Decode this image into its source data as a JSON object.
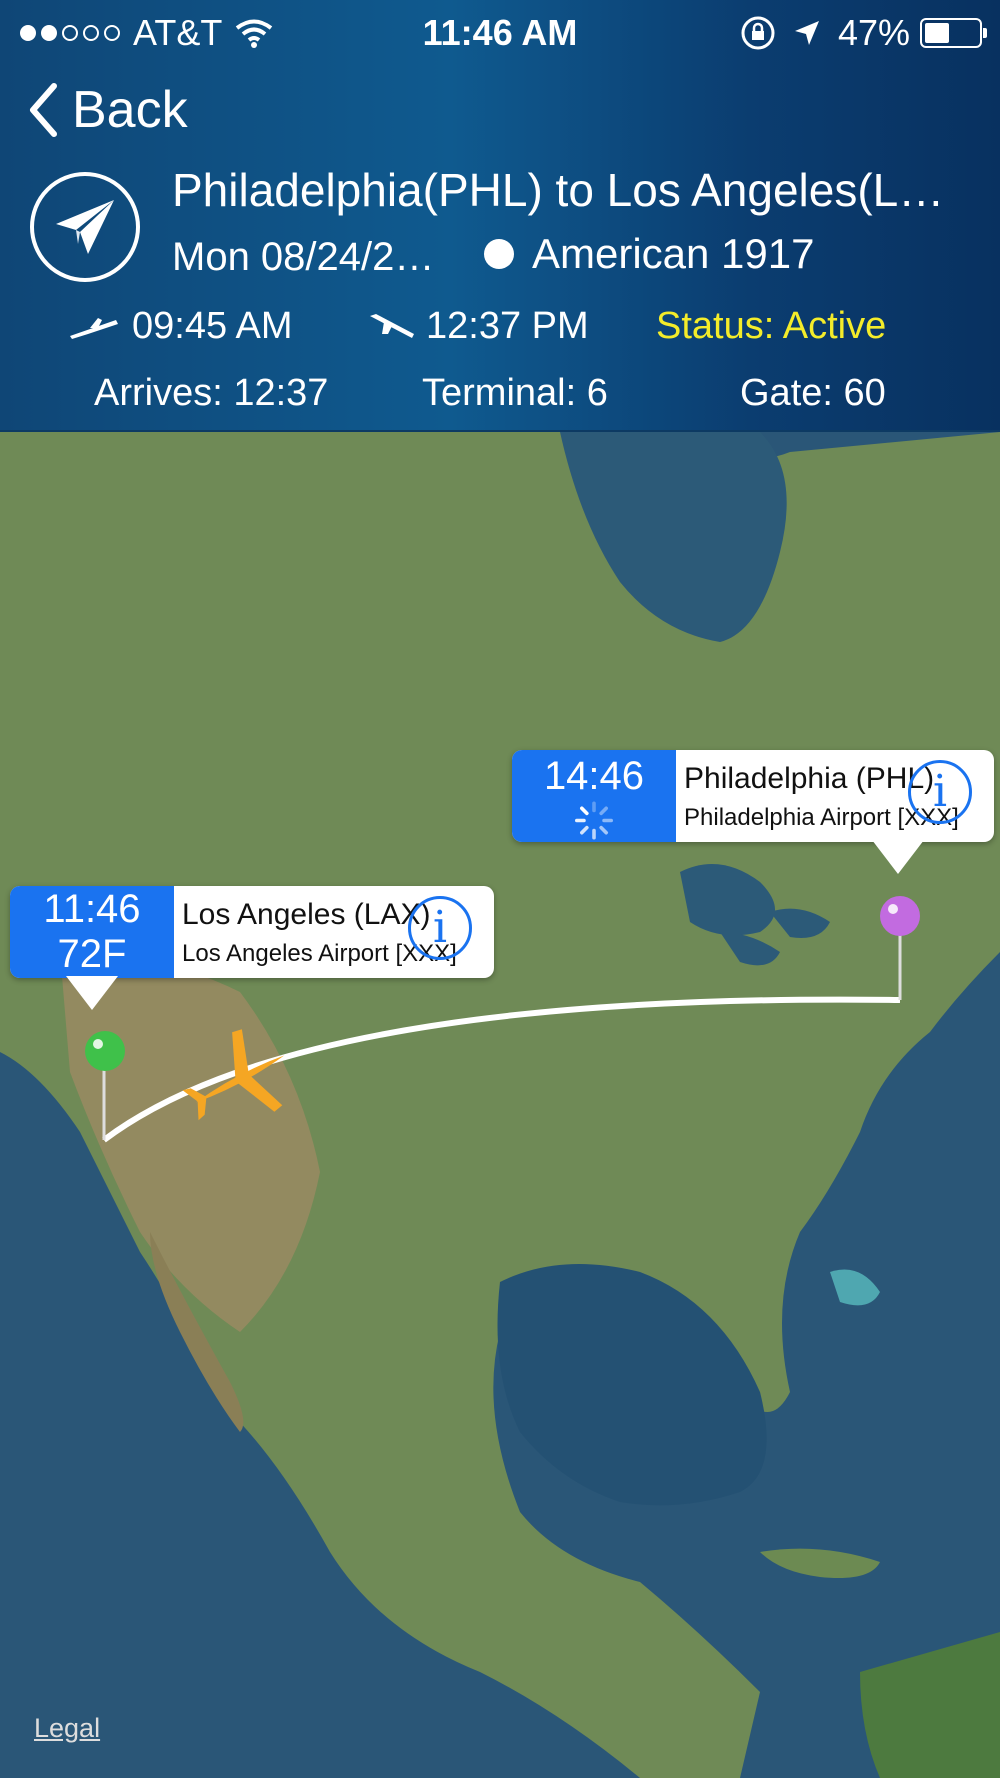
{
  "status_bar": {
    "carrier": "AT&T",
    "signal_full": 2,
    "signal_total": 5,
    "time": "11:46 AM",
    "battery": "47%",
    "battery_level": 0.47
  },
  "nav": {
    "back_label": "Back"
  },
  "flight": {
    "route": "Philadelphia(PHL) to Los Angeles(L…",
    "date": "Mon 08/24/2…",
    "airline": "American 1917",
    "departure_time": "09:45 AM",
    "arrival_time": "12:37 PM",
    "status": "Status: Active",
    "arrives": "Arrives: 12:37",
    "terminal": "Terminal: 6",
    "gate": "Gate: 60"
  },
  "map": {
    "origin": {
      "time": "14:46",
      "name": "Philadelphia (PHL)",
      "airport": "Philadelphia Airport [XXX]",
      "pin_color": "#c26be0"
    },
    "destination": {
      "time": "11:46",
      "temp": "72F",
      "name": "Los Angeles (LAX)",
      "airport": "Los Angeles Airport [XXX]",
      "pin_color": "#3fc14a"
    },
    "plane_color": "#f5a623",
    "legal_label": "Legal"
  },
  "colors": {
    "status_yellow": "#f4ec2a",
    "callout_blue": "#1a73f0"
  }
}
